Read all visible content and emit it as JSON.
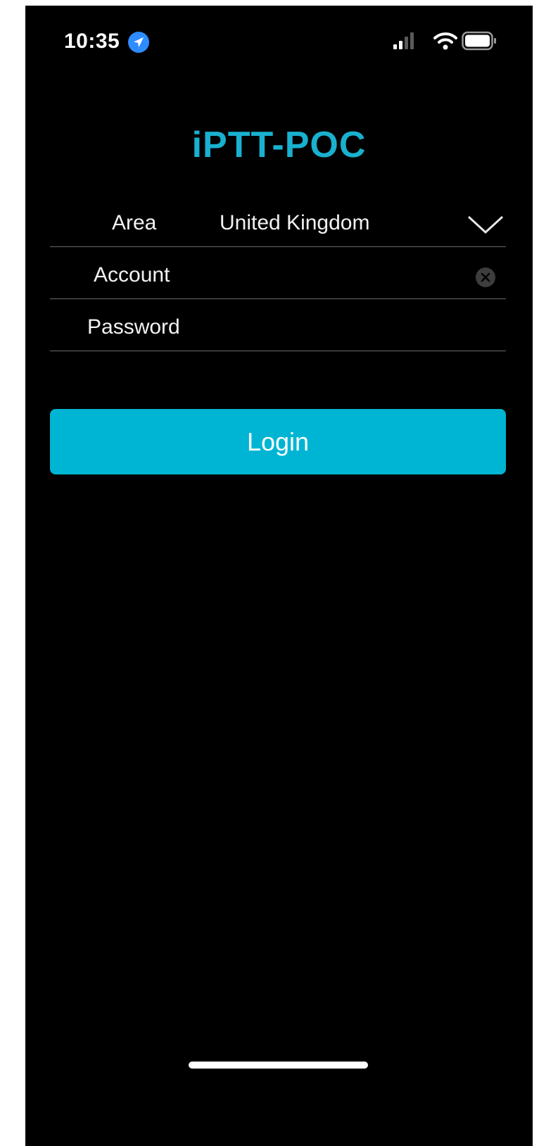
{
  "status_bar": {
    "time": "10:35",
    "icons": [
      "location-icon",
      "signal-icon",
      "wifi-icon",
      "battery-icon"
    ]
  },
  "app": {
    "title": "iPTT-POC"
  },
  "form": {
    "area": {
      "label": "Area",
      "value": "United Kingdom",
      "icon": "chevron-down-icon"
    },
    "account": {
      "label": "Account",
      "value": "",
      "clear_icon": "clear-icon"
    },
    "password": {
      "label": "Password",
      "value": ""
    }
  },
  "login_button": {
    "label": "Login"
  },
  "colors": {
    "background": "#000000",
    "accent": "#00b5d3",
    "title": "#19b1cf",
    "location_badge": "#2f8cff"
  }
}
